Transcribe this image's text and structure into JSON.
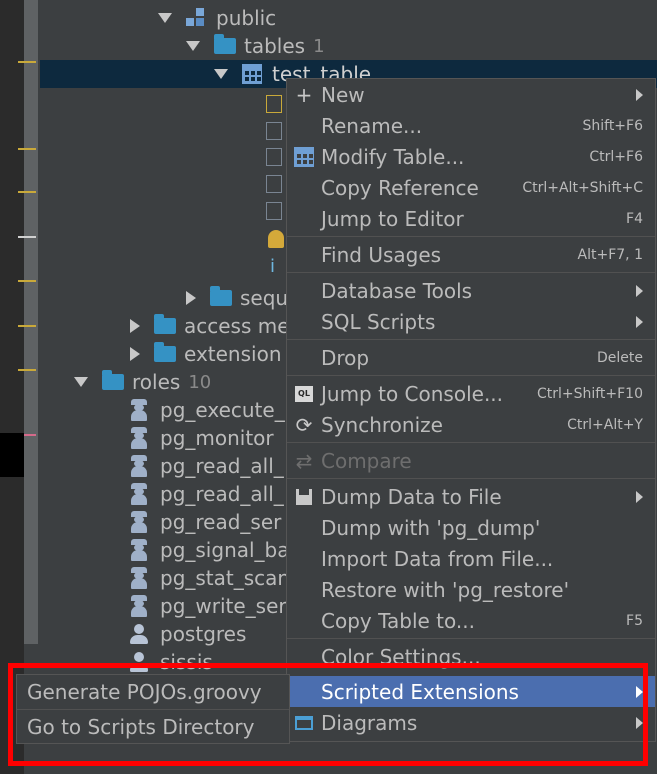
{
  "tree": {
    "public": "public",
    "tables": "tables",
    "tables_count": "1",
    "test_table": "test_table",
    "sequences": "sequ",
    "access_methods": "access me",
    "extensions": "extension",
    "roles": "roles",
    "roles_count": "10",
    "role_items": [
      "pg_execute_",
      "pg_monitor",
      "pg_read_all_",
      "pg_read_all_",
      "pg_read_ser",
      "pg_signal_ba",
      "pg_stat_scan",
      "pg_write_ser",
      "postgres",
      "sissis"
    ]
  },
  "context_menu": {
    "items": [
      {
        "label": "New",
        "shortcut": "",
        "submenu": true,
        "icon": "plus-icon"
      },
      {
        "label": "Rename...",
        "shortcut": "Shift+F6",
        "submenu": false,
        "icon": ""
      },
      {
        "label": "Modify Table...",
        "shortcut": "Ctrl+F6",
        "submenu": false,
        "icon": "table-icon"
      },
      {
        "label": "Copy Reference",
        "shortcut": "Ctrl+Alt+Shift+C",
        "submenu": false,
        "icon": ""
      },
      {
        "label": "Jump to Editor",
        "shortcut": "F4",
        "submenu": false,
        "icon": ""
      },
      {
        "label": "Find Usages",
        "shortcut": "Alt+F7, 1",
        "submenu": false,
        "icon": ""
      },
      {
        "label": "Database Tools",
        "shortcut": "",
        "submenu": true,
        "icon": ""
      },
      {
        "label": "SQL Scripts",
        "shortcut": "",
        "submenu": true,
        "icon": ""
      },
      {
        "label": "Drop",
        "shortcut": "Delete",
        "submenu": false,
        "icon": ""
      },
      {
        "label": "Jump to Console...",
        "shortcut": "Ctrl+Shift+F10",
        "submenu": false,
        "icon": "console-icon"
      },
      {
        "label": "Synchronize",
        "shortcut": "Ctrl+Alt+Y",
        "submenu": false,
        "icon": "sync-icon"
      },
      {
        "label": "Compare",
        "shortcut": "",
        "submenu": false,
        "icon": "compare-icon",
        "disabled": true
      },
      {
        "label": "Dump Data to File",
        "shortcut": "",
        "submenu": true,
        "icon": "save-icon"
      },
      {
        "label": "Dump with 'pg_dump'",
        "shortcut": "",
        "submenu": false,
        "icon": ""
      },
      {
        "label": "Import Data from File...",
        "shortcut": "",
        "submenu": false,
        "icon": ""
      },
      {
        "label": "Restore with 'pg_restore'",
        "shortcut": "",
        "submenu": false,
        "icon": ""
      },
      {
        "label": "Copy Table to...",
        "shortcut": "F5",
        "submenu": false,
        "icon": ""
      },
      {
        "label": "Color Settings...",
        "shortcut": "",
        "submenu": false,
        "icon": ""
      },
      {
        "label": "Scripted Extensions",
        "shortcut": "",
        "submenu": true,
        "icon": "",
        "active": true
      },
      {
        "label": "Diagrams",
        "shortcut": "",
        "submenu": true,
        "icon": "diagram-icon"
      }
    ]
  },
  "submenu": {
    "items": [
      "Generate POJOs.groovy",
      "Go to Scripts Directory"
    ]
  },
  "colors": {
    "background": "#3c3f41",
    "selection": "#0d293e",
    "menu_active": "#4b6eaf",
    "highlight_box": "#ff0000",
    "folder": "#3592c4"
  }
}
